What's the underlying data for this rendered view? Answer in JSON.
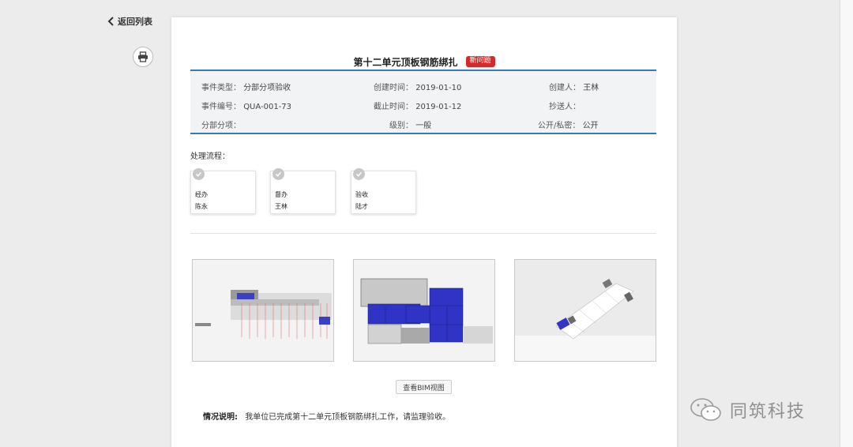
{
  "nav": {
    "back_label": "返回列表"
  },
  "event": {
    "title": "第十二单元顶板钢筋绑扎",
    "status_badge": "新问题"
  },
  "info": {
    "type_label": "事件类型：",
    "type_value": "分部分项验收",
    "created_time_label": "创建时间：",
    "created_time_value": "2019-01-10",
    "creator_label": "创建人：",
    "creator_value": "王林",
    "number_label": "事件编号：",
    "number_value": "QUA-001-73",
    "deadline_label": "截止时间：",
    "deadline_value": "2019-01-12",
    "cc_label": "抄送人：",
    "cc_value": "",
    "subsection_label": "分部分项：",
    "subsection_value": "",
    "level_label": "级别：",
    "level_value": "一般",
    "visibility_label": "公开/私密：",
    "visibility_value": "公开"
  },
  "flow": {
    "label": "处理流程：",
    "steps": [
      {
        "role": "经办",
        "person": "陈永"
      },
      {
        "role": "督办",
        "person": "王林"
      },
      {
        "role": "验收",
        "person": "陆才"
      }
    ]
  },
  "actions": {
    "view_bim_label": "查看BIM视图"
  },
  "description": {
    "label": "情况说明:",
    "text": "我单位已完成第十二单元顶板钢筋绑扎工作，请监理验收。"
  },
  "watermark": {
    "text": "同筑科技"
  },
  "colors": {
    "accent_blue": "#3b79b5",
    "badge_red": "#d32a2a",
    "model_blue": "#2b32c9"
  }
}
